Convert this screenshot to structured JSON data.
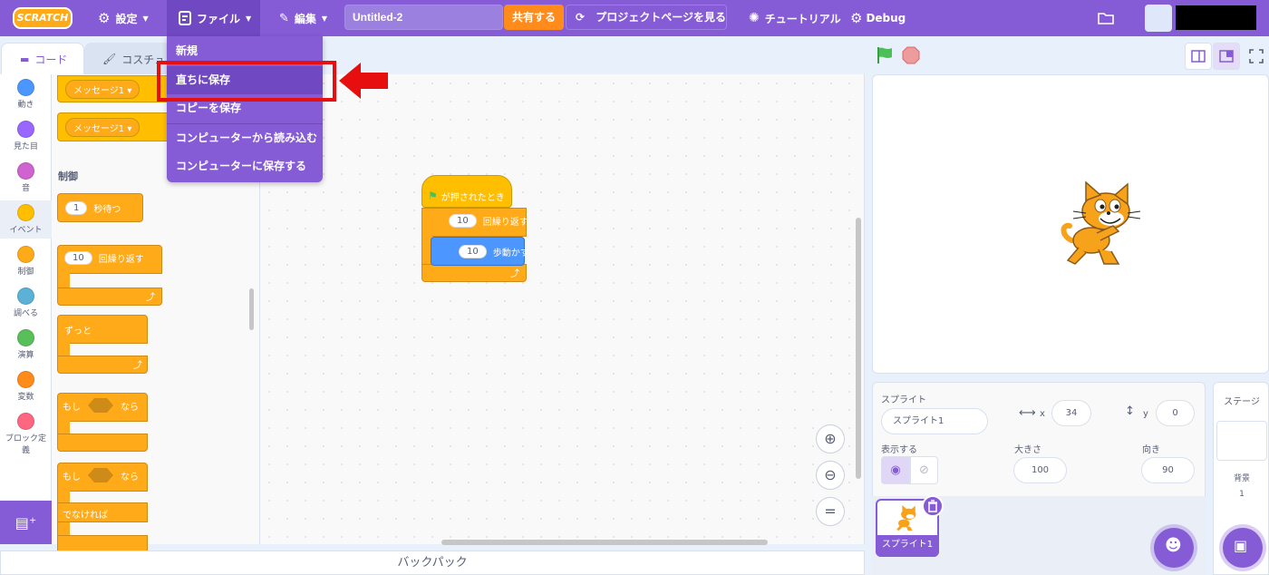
{
  "menubar": {
    "logo": "SCRATCH",
    "settings": "設定",
    "file": "ファイル",
    "edit": "編集",
    "project_title": "Untitled-2",
    "share": "共有する",
    "project_page": "プロジェクトページを見る",
    "tutorials": "チュートリアル",
    "debug": "Debug"
  },
  "file_menu": {
    "items": [
      "新規",
      "直ちに保存",
      "コピーを保存",
      "コンピューターから読み込む",
      "コンピューターに保存する"
    ],
    "highlighted": "直ちに保存"
  },
  "tabs": {
    "code": "コード",
    "costumes": "コスチュ"
  },
  "categories": [
    {
      "label": "動き",
      "color": "#4c97ff"
    },
    {
      "label": "見た目",
      "color": "#9966ff"
    },
    {
      "label": "音",
      "color": "#cf63cf"
    },
    {
      "label": "イベント",
      "color": "#ffbf00"
    },
    {
      "label": "制御",
      "color": "#ffab19"
    },
    {
      "label": "調べる",
      "color": "#5cb1d6"
    },
    {
      "label": "演算",
      "color": "#59c059"
    },
    {
      "label": "変数",
      "color": "#ff8c1a"
    },
    {
      "label": "ブロック定義",
      "color": "#ff6680"
    }
  ],
  "palette": {
    "message1": "メッセージ1",
    "section_control": "制御",
    "wait_value": "1",
    "wait_label": "秒待つ",
    "repeat_value": "10",
    "repeat_label": "回繰り返す",
    "forever": "ずっと",
    "if_label": "もし",
    "then_label": "なら",
    "else_label": "でなければ"
  },
  "script": {
    "hat": "が押されたとき",
    "repeat_value": "10",
    "repeat_label": "回繰り返す",
    "move_value": "10",
    "move_label": "歩動かす"
  },
  "sprite_info": {
    "sprite_label": "スプライト",
    "sprite_name": "スプライト1",
    "x_label": "x",
    "x": "34",
    "y_label": "y",
    "y": "0",
    "show_label": "表示する",
    "size_label": "大きさ",
    "size": "100",
    "direction_label": "向き",
    "direction": "90",
    "tile_name": "スプライト1"
  },
  "stage_panel": {
    "title": "ステージ",
    "backdrops_label": "背景",
    "backdrops_count": "1"
  },
  "backpack": "バックパック",
  "colors": {
    "menubar": "#855cd6",
    "control": "#ffab19",
    "event": "#ffbf00",
    "motion": "#4c97ff",
    "share": "#ff8c1a",
    "highlight": "#e60e0e"
  }
}
